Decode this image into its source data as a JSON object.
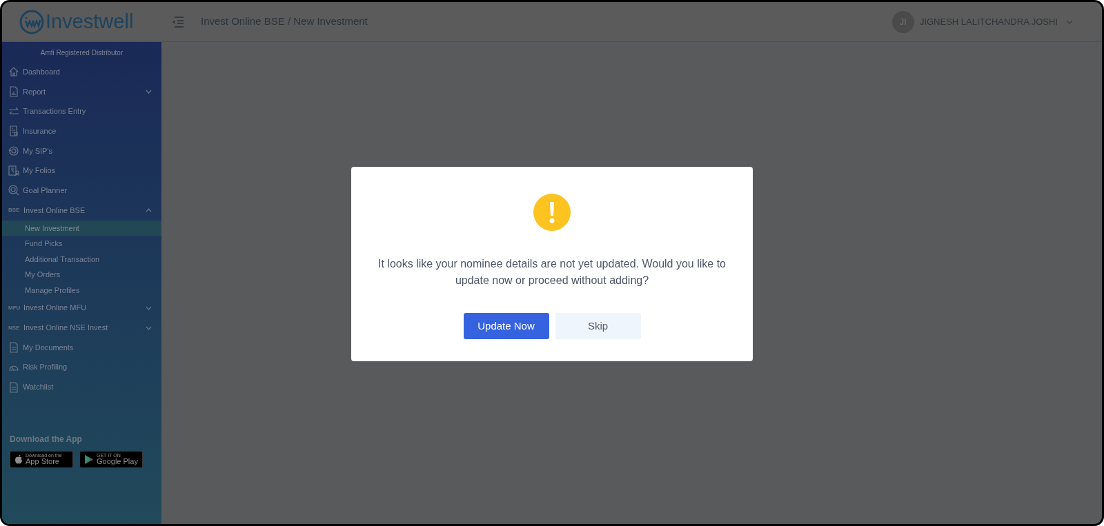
{
  "header": {
    "app_name": "Investwell",
    "breadcrumb": "Invest Online BSE / New Investment",
    "user": {
      "initials": "JI",
      "name": "JIGNESH LALITCHANDRA JOSHI"
    }
  },
  "sidebar": {
    "tagline": "Amfi Registered Distributor",
    "items": [
      {
        "label": "Dashboard"
      },
      {
        "label": "Report",
        "expanded": false
      },
      {
        "label": "Transactions Entry"
      },
      {
        "label": "Insurance"
      },
      {
        "label": "My SIP's"
      },
      {
        "label": "My Folios"
      },
      {
        "label": "Goal Planner"
      },
      {
        "label": "Invest Online BSE",
        "prefix": "BSE",
        "expanded": true,
        "children": [
          {
            "label": "New Investment",
            "selected": true
          },
          {
            "label": "Fund Picks",
            "selected": false
          },
          {
            "label": "Additional Transaction",
            "selected": false
          },
          {
            "label": "My Orders",
            "selected": false
          },
          {
            "label": "Manage Profiles",
            "selected": false
          }
        ]
      },
      {
        "label": "Invest Online MFU",
        "prefix": "MFU",
        "expanded": false
      },
      {
        "label": "Invest Online NSE Invest",
        "prefix": "NSE",
        "expanded": false
      },
      {
        "label": "My Documents"
      },
      {
        "label": "Risk Profiling"
      },
      {
        "label": "Watchlist"
      }
    ],
    "download": {
      "title": "Download the App",
      "stores": [
        {
          "kind": "apple",
          "small": "Download on the",
          "big": "App Store"
        },
        {
          "kind": "google",
          "small": "GET IT ON",
          "big": "Google Play"
        }
      ]
    }
  },
  "modal": {
    "message": "It looks like your nominee details are not yet updated. Would you like to update now or proceed without adding?",
    "buttons": [
      {
        "label": "Update Now",
        "kind": "primary"
      },
      {
        "label": "Skip",
        "kind": "secondary"
      }
    ]
  }
}
